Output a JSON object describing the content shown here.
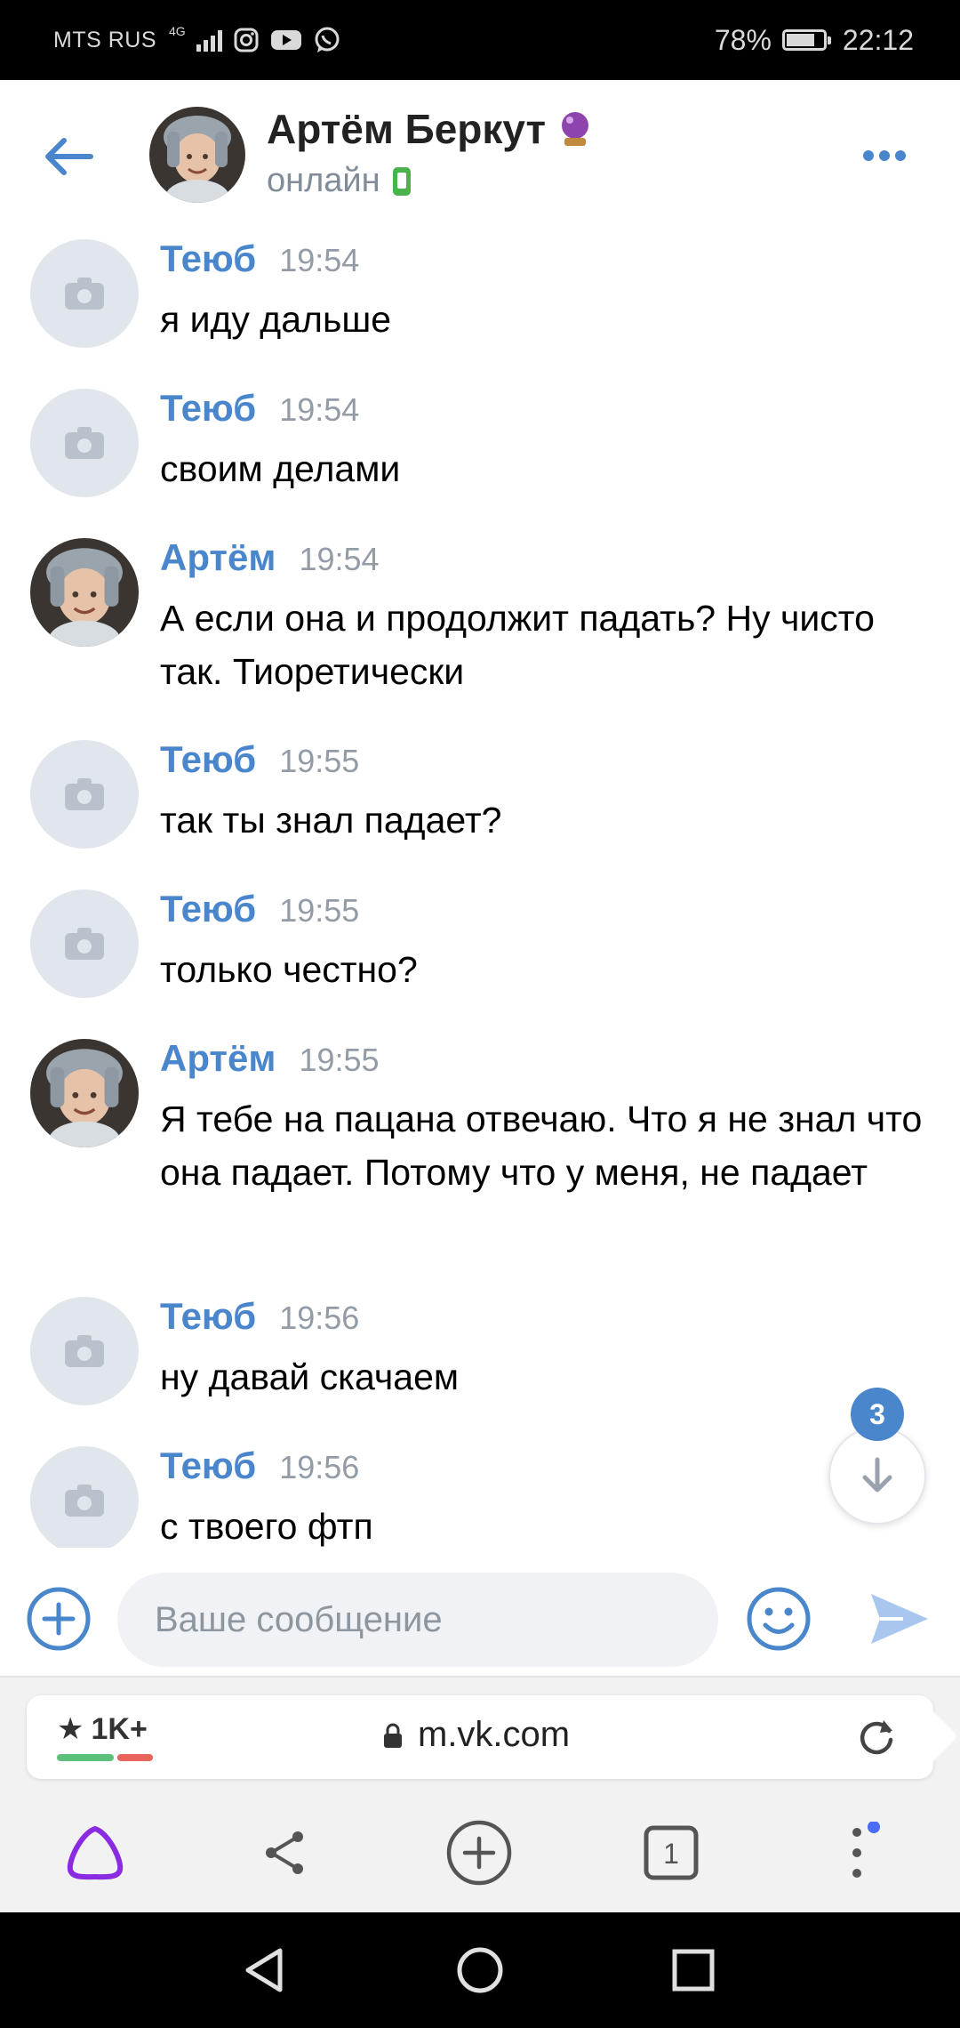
{
  "status_bar": {
    "carrier": "MTS RUS",
    "network": "4G",
    "icons": [
      "instagram-icon",
      "youtube-icon",
      "whatsapp-icon"
    ],
    "battery_percent_text": "78%",
    "battery_level": 0.78,
    "time": "22:12"
  },
  "header": {
    "name": "Артём Беркут",
    "status": "онлайн",
    "badge_icon": "crystal-ball-icon",
    "back_icon": "back-arrow-icon",
    "more_icon": "more-dots-icon"
  },
  "messages": [
    {
      "author": "Теюб",
      "time": "19:54",
      "text": "я иду дальше",
      "avatar": "camera-placeholder"
    },
    {
      "author": "Теюб",
      "time": "19:54",
      "text": "своим делами",
      "avatar": "camera-placeholder"
    },
    {
      "author": "Артём",
      "time": "19:54",
      "text": "А если она и продолжит падать? Ну чисто так. Тиоретически",
      "avatar": "photo"
    },
    {
      "author": "Теюб",
      "time": "19:55",
      "text": "так ты знал падает?",
      "avatar": "camera-placeholder"
    },
    {
      "author": "Теюб",
      "time": "19:55",
      "text": "только честно?",
      "avatar": "camera-placeholder"
    },
    {
      "author": "Артём",
      "time": "19:55",
      "text": "Я тебе на пацана отвечаю. Что я не знал что она падает. Потому что у меня, не падает",
      "avatar": "photo"
    },
    {
      "author": "Теюб",
      "time": "19:56",
      "text": "ну давай скачаем",
      "avatar": "camera-placeholder"
    },
    {
      "author": "Теюб",
      "time": "19:56",
      "text": "с твоего фтп",
      "avatar": "camera-placeholder"
    }
  ],
  "scroll": {
    "unread_count": "3"
  },
  "composer": {
    "placeholder": "Ваше сообщение",
    "value": ""
  },
  "browser": {
    "rating": "1K+",
    "url": "m.vk.com",
    "tab_count": "1"
  },
  "colors": {
    "accent": "#4986cc",
    "author": "#4986cc",
    "online": "#4bb34b",
    "alice": "#8a2be2",
    "badge": "#4986cc"
  }
}
